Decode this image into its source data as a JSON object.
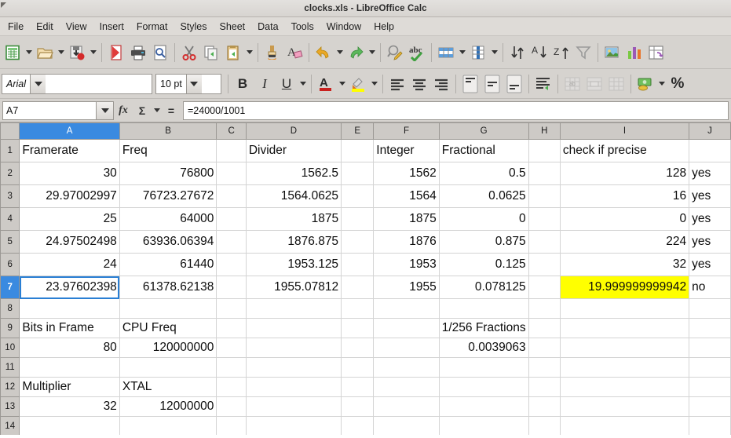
{
  "window": {
    "title": "clocks.xls - LibreOffice Calc"
  },
  "menubar": {
    "items": [
      "File",
      "Edit",
      "View",
      "Insert",
      "Format",
      "Styles",
      "Sheet",
      "Data",
      "Tools",
      "Window",
      "Help"
    ]
  },
  "toolbar_main": {
    "buttons": [
      "new-document-icon",
      "open-document-icon",
      "save-document-icon",
      "export-pdf-icon",
      "print-icon",
      "print-preview-icon",
      "cut-icon",
      "copy-icon",
      "paste-icon",
      "clone-formatting-icon",
      "clear-formatting-icon",
      "undo-icon",
      "redo-icon",
      "find-replace-icon",
      "spelling-icon",
      "row-icon",
      "column-icon",
      "sort-icon",
      "sort-ascending-icon",
      "sort-descending-icon",
      "autofilter-icon",
      "insert-image-icon",
      "insert-chart-icon",
      "pivot-table-icon"
    ]
  },
  "toolbar_format": {
    "font_name": "Arial",
    "font_size": "10 pt",
    "bold_label": "B",
    "italic_label": "I",
    "underline_label": "U",
    "buttons": [
      "bold-icon",
      "italic-icon",
      "underline-icon",
      "font-color-icon",
      "highlight-color-icon",
      "align-left-icon",
      "align-center-icon",
      "align-right-icon",
      "align-top-icon",
      "align-middle-icon",
      "align-bottom-icon",
      "wrap-text-icon",
      "merge-cells-icon",
      "merge-center-icon",
      "unmerge-cells-icon",
      "format-currency-icon",
      "format-percent-icon"
    ]
  },
  "formula_bar": {
    "name_box": "A7",
    "function_wizard_label": "fx",
    "sum_label": "Σ",
    "formula_label": "=",
    "input_line": "=24000/1001"
  },
  "sheet": {
    "selected_cell": "A7",
    "selected_column": "A",
    "selected_row": "7",
    "columns": [
      "A",
      "B",
      "C",
      "D",
      "E",
      "F",
      "G",
      "H",
      "I",
      "J"
    ],
    "rows": [
      "1",
      "2",
      "3",
      "4",
      "5",
      "6",
      "7",
      "8",
      "9",
      "10",
      "11",
      "12",
      "13",
      "14"
    ],
    "highlight_color": "#ffff00",
    "data": [
      {
        "row": "1",
        "A": "Framerate",
        "B": "Freq",
        "C": "",
        "D": "Divider",
        "E": "",
        "F": "Integer",
        "G": "Fractional",
        "H": "",
        "I": "check if precise",
        "J": ""
      },
      {
        "row": "2",
        "A": "30",
        "B": "76800",
        "C": "",
        "D": "1562.5",
        "E": "",
        "F": "1562",
        "G": "0.5",
        "H": "",
        "I": "128",
        "J": "yes"
      },
      {
        "row": "3",
        "A": "29.97002997",
        "B": "76723.27672",
        "C": "",
        "D": "1564.0625",
        "E": "",
        "F": "1564",
        "G": "0.0625",
        "H": "",
        "I": "16",
        "J": "yes"
      },
      {
        "row": "4",
        "A": "25",
        "B": "64000",
        "C": "",
        "D": "1875",
        "E": "",
        "F": "1875",
        "G": "0",
        "H": "",
        "I": "0",
        "J": "yes"
      },
      {
        "row": "5",
        "A": "24.97502498",
        "B": "63936.06394",
        "C": "",
        "D": "1876.875",
        "E": "",
        "F": "1876",
        "G": "0.875",
        "H": "",
        "I": "224",
        "J": "yes"
      },
      {
        "row": "6",
        "A": "24",
        "B": "61440",
        "C": "",
        "D": "1953.125",
        "E": "",
        "F": "1953",
        "G": "0.125",
        "H": "",
        "I": "32",
        "J": "yes"
      },
      {
        "row": "7",
        "A": "23.97602398",
        "B": "61378.62138",
        "C": "",
        "D": "1955.07812",
        "E": "",
        "F": "1955",
        "G": "0.078125",
        "H": "",
        "I": "19.999999999942",
        "J": "no"
      },
      {
        "row": "8",
        "A": "",
        "B": "",
        "C": "",
        "D": "",
        "E": "",
        "F": "",
        "G": "",
        "H": "",
        "I": "",
        "J": ""
      },
      {
        "row": "9",
        "A": "Bits in Frame",
        "B": "CPU Freq",
        "C": "",
        "D": "",
        "E": "",
        "F": "",
        "G": "1/256 Fractions",
        "H": "",
        "I": "",
        "J": ""
      },
      {
        "row": "10",
        "A": "80",
        "B": "120000000",
        "C": "",
        "D": "",
        "E": "",
        "F": "",
        "G": "0.0039063",
        "H": "",
        "I": "",
        "J": ""
      },
      {
        "row": "11",
        "A": "",
        "B": "",
        "C": "",
        "D": "",
        "E": "",
        "F": "",
        "G": "",
        "H": "",
        "I": "",
        "J": ""
      },
      {
        "row": "12",
        "A": "Multiplier",
        "B": "XTAL",
        "C": "",
        "D": "",
        "E": "",
        "F": "",
        "G": "",
        "H": "",
        "I": "",
        "J": ""
      },
      {
        "row": "13",
        "A": "32",
        "B": "12000000",
        "C": "",
        "D": "",
        "E": "",
        "F": "",
        "G": "",
        "H": "",
        "I": "",
        "J": ""
      },
      {
        "row": "14",
        "A": "",
        "B": "",
        "C": "",
        "D": "",
        "E": "",
        "F": "",
        "G": "",
        "H": "",
        "I": "",
        "J": ""
      }
    ],
    "alignment": {
      "1": {
        "A": "txt",
        "B": "txt",
        "D": "txt",
        "F": "txt",
        "G": "txt",
        "I": "txt"
      },
      "2": {
        "A": "num",
        "B": "num",
        "D": "num",
        "F": "num",
        "G": "num",
        "I": "num",
        "J": "txt"
      },
      "3": {
        "A": "num",
        "B": "num",
        "D": "num",
        "F": "num",
        "G": "num",
        "I": "num",
        "J": "txt"
      },
      "4": {
        "A": "num",
        "B": "num",
        "D": "num",
        "F": "num",
        "G": "num",
        "I": "num",
        "J": "txt"
      },
      "5": {
        "A": "num",
        "B": "num",
        "D": "num",
        "F": "num",
        "G": "num",
        "I": "num",
        "J": "txt"
      },
      "6": {
        "A": "num",
        "B": "num",
        "D": "num",
        "F": "num",
        "G": "num",
        "I": "num",
        "J": "txt"
      },
      "7": {
        "A": "num",
        "B": "num",
        "D": "num",
        "F": "num",
        "G": "num",
        "I": "num",
        "J": "txt"
      },
      "9": {
        "A": "txt",
        "B": "txt",
        "G": "txt"
      },
      "10": {
        "A": "num",
        "B": "num",
        "G": "num"
      },
      "12": {
        "A": "txt",
        "B": "txt"
      },
      "13": {
        "A": "num",
        "B": "num"
      }
    },
    "highlighted_cells": [
      "I7"
    ]
  }
}
